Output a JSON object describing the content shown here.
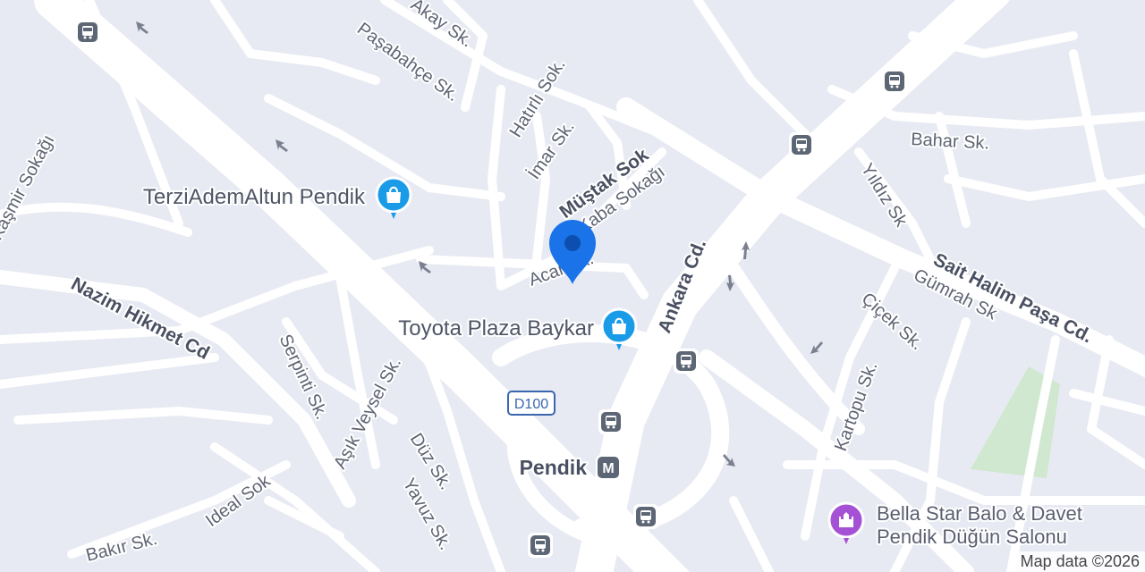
{
  "attribution": "Map data ©2026",
  "streets": {
    "akay": "Akay Sk.",
    "pasabahce": "Paşabahçe Sk.",
    "hatirli": "Hatırlı Sok.",
    "imar": "İmar Sk.",
    "mustak": "Müştak Sok",
    "aba": "Kaba Sokağı",
    "acar": "Acar Sk.",
    "kasmir": "Kaşmir Sokağı",
    "nazim": "Nazim Hikmet Cd",
    "serpinti": "Serpinti Sk.",
    "asik": "Aşık Veysel Sk.",
    "duz": "Düz Sk.",
    "yavuz": "Yavuz Sk.",
    "ideal": "Ideal Sok",
    "bakir": "Bakır Sk.",
    "ankara": "Ankara Cd.",
    "bahar": "Bahar Sk.",
    "yildiz": "Yıldız Sk",
    "sait": "Sait Halim Paşa Cd.",
    "gumrah": "Gümrah Sk",
    "cicek": "Çiçek Sk.",
    "kartopu": "Kartopu Sk."
  },
  "road_shield": "D100",
  "pois": {
    "terzi": "TerziAdemAltun Pendik",
    "toyota": "Toyota Plaza Baykar",
    "pendik": "Pendik",
    "metro_letter": "M",
    "bella_line1": "Bella Star Balo & Davet",
    "bella_line2": "Pendik Düğün Salonu"
  },
  "colors": {
    "background": "#e8eaf3",
    "road": "#ffffff",
    "park": "#cfe8cf",
    "shopping_pin": "#1a9be8",
    "venue_pin": "#a551d6",
    "location_pin": "#1a73e8",
    "transit_icon": "#5c6674"
  },
  "icons": {
    "bus_stop": "bus-icon",
    "shopping": "shopping-bag-icon",
    "metro": "metro-icon",
    "venue": "castle-icon",
    "pin": "location-pin-icon",
    "arrow": "one-way-arrow-icon"
  }
}
